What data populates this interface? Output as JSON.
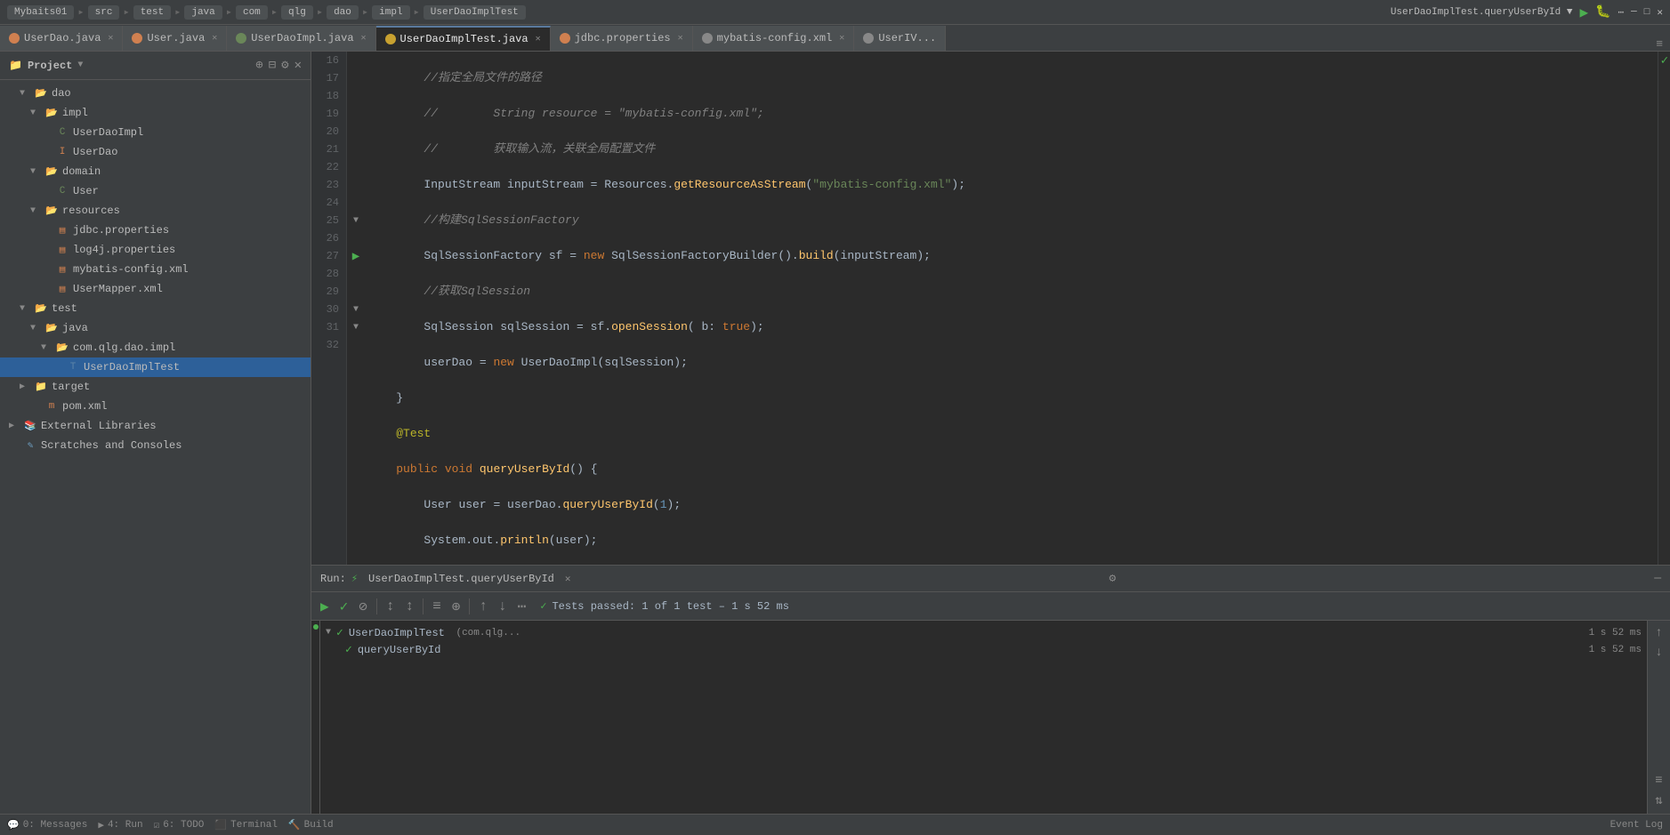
{
  "titlebar": {
    "tabs": [
      {
        "label": "Mybaits01",
        "active": false
      },
      {
        "label": "src",
        "active": false
      },
      {
        "label": "test",
        "active": false
      },
      {
        "label": "java",
        "active": false
      },
      {
        "label": "com",
        "active": false
      },
      {
        "label": "qlg",
        "active": false
      },
      {
        "label": "dao",
        "active": false
      },
      {
        "label": "impl",
        "active": false
      },
      {
        "label": "UserDaoImplTest",
        "active": false
      }
    ],
    "right": "UserDaoImplTest.queryUserById ▼"
  },
  "editor_tabs": [
    {
      "label": "UserDao.java",
      "icon_color": "#d08050",
      "active": false,
      "closeable": true
    },
    {
      "label": "User.java",
      "icon_color": "#d08050",
      "active": false,
      "closeable": true
    },
    {
      "label": "UserDaoImpl.java",
      "icon_color": "#6a8759",
      "active": false,
      "closeable": true
    },
    {
      "label": "UserDaoImplTest.java",
      "icon_color": "#c8a130",
      "active": true,
      "closeable": true
    },
    {
      "label": "jdbc.properties",
      "icon_color": "#d08050",
      "active": false,
      "closeable": true
    },
    {
      "label": "mybatis-config.xml",
      "icon_color": "#888",
      "active": false,
      "closeable": true
    },
    {
      "label": "UserIV...",
      "icon_color": "#888",
      "active": false,
      "closeable": false
    }
  ],
  "sidebar": {
    "title": "Project",
    "tree": [
      {
        "indent": 2,
        "type": "folder",
        "arrow": "▼",
        "label": "dao",
        "color": "folder-blue"
      },
      {
        "indent": 3,
        "type": "folder",
        "arrow": "▼",
        "label": "impl",
        "color": "folder-blue"
      },
      {
        "indent": 4,
        "type": "file",
        "arrow": "",
        "label": "UserDaoImpl",
        "color": "file-green"
      },
      {
        "indent": 4,
        "type": "file",
        "arrow": "",
        "label": "UserDao",
        "color": "file-orange"
      },
      {
        "indent": 3,
        "type": "folder",
        "arrow": "▼",
        "label": "domain",
        "color": "folder-blue"
      },
      {
        "indent": 4,
        "type": "file",
        "arrow": "",
        "label": "User",
        "color": "file-green"
      },
      {
        "indent": 3,
        "type": "folder",
        "arrow": "▼",
        "label": "resources",
        "color": "folder-blue"
      },
      {
        "indent": 4,
        "type": "file",
        "arrow": "",
        "label": "jdbc.properties",
        "color": "file-orange"
      },
      {
        "indent": 4,
        "type": "file",
        "arrow": "",
        "label": "log4j.properties",
        "color": "file-orange"
      },
      {
        "indent": 4,
        "type": "file",
        "arrow": "",
        "label": "mybatis-config.xml",
        "color": "file-orange"
      },
      {
        "indent": 4,
        "type": "file",
        "arrow": "",
        "label": "UserMapper.xml",
        "color": "file-orange"
      },
      {
        "indent": 2,
        "type": "folder",
        "arrow": "▼",
        "label": "test",
        "color": "folder-yellow"
      },
      {
        "indent": 3,
        "type": "folder",
        "arrow": "▼",
        "label": "java",
        "color": "folder-yellow"
      },
      {
        "indent": 4,
        "type": "folder",
        "arrow": "▼",
        "label": "com.qlg.dao.impl",
        "color": "folder-yellow"
      },
      {
        "indent": 5,
        "type": "file",
        "arrow": "",
        "label": "UserDaoImplTest",
        "color": "file-blue",
        "selected": true
      },
      {
        "indent": 2,
        "type": "folder",
        "arrow": "▶",
        "label": "target",
        "color": "folder-blue"
      },
      {
        "indent": 3,
        "type": "file",
        "arrow": "",
        "label": "pom.xml",
        "color": "file-orange"
      },
      {
        "indent": 1,
        "type": "folder",
        "arrow": "▶",
        "label": "External Libraries",
        "color": "folder-blue"
      },
      {
        "indent": 1,
        "type": "folder",
        "arrow": "",
        "label": "Scratches and Consoles",
        "color": "folder-blue"
      }
    ]
  },
  "code": {
    "lines": [
      {
        "num": 16,
        "gutter": "",
        "text": "        //指定全局文件的路径"
      },
      {
        "num": 17,
        "gutter": "",
        "text": "        //        String resource = \"mybatis-config.xml\";"
      },
      {
        "num": 18,
        "gutter": "",
        "text": "        //        获取输入流，关联全局配置文件"
      },
      {
        "num": 19,
        "gutter": "",
        "text": "        InputStream inputStream = Resources.getResourceAsStream(\"mybatis-config.xml\");"
      },
      {
        "num": 20,
        "gutter": "",
        "text": "        //构建SqlSessionFactory"
      },
      {
        "num": 21,
        "gutter": "",
        "text": "        SqlSessionFactory sf = new SqlSessionFactoryBuilder().build(inputStream);"
      },
      {
        "num": 22,
        "gutter": "",
        "text": "        //获取SqlSession"
      },
      {
        "num": 23,
        "gutter": "",
        "text": "        SqlSession sqlSession = sf.openSession( b: true);"
      },
      {
        "num": 24,
        "gutter": "",
        "text": "        userDao = new UserDaoImpl(sqlSession);"
      },
      {
        "num": 25,
        "gutter": "fold",
        "text": "    }"
      },
      {
        "num": 26,
        "gutter": "",
        "text": "    @Test"
      },
      {
        "num": 27,
        "gutter": "run",
        "text": "    public void queryUserById() {"
      },
      {
        "num": 28,
        "gutter": "",
        "text": "        User user = userDao.queryUserById(1);"
      },
      {
        "num": 29,
        "gutter": "",
        "text": "        System.out.println(user);"
      },
      {
        "num": 30,
        "gutter": "fold",
        "text": "    }"
      },
      {
        "num": 31,
        "gutter": "fold",
        "text": "}"
      },
      {
        "num": 32,
        "gutter": "",
        "text": ""
      }
    ]
  },
  "run_panel": {
    "title": "Run:",
    "tab": "UserDaoImplTest.queryUserById",
    "status": "Tests passed: 1 of 1 test – 1 s 52 ms",
    "toolbar_buttons": [
      "▶",
      "✓",
      "⊘",
      "↓↑",
      "↑↓",
      "≡",
      "⊕",
      "↑",
      "↓",
      "⋯"
    ],
    "tree_items": [
      {
        "indent": 0,
        "check": "✓",
        "label": "UserDaoImplTest",
        "sub": "(com.qlg...",
        "time": "1 s 52 ms",
        "expanded": true
      },
      {
        "indent": 1,
        "check": "✓",
        "label": "queryUserById",
        "sub": "",
        "time": "1 s 52 ms",
        "expanded": false
      }
    ]
  },
  "status_bar": {
    "items": [
      {
        "label": "0: Messages"
      },
      {
        "label": "4: Run"
      },
      {
        "label": "6: TODO"
      },
      {
        "label": "Terminal"
      },
      {
        "label": "Build"
      }
    ],
    "right": "Event Log"
  }
}
